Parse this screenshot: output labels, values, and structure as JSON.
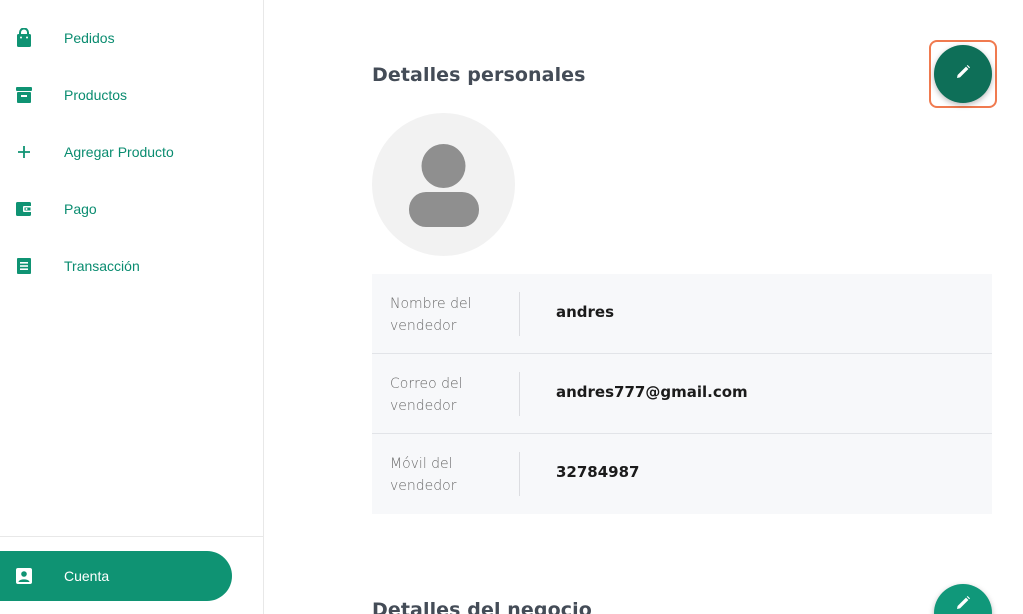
{
  "sidebar": {
    "items": [
      {
        "label": "Pedidos",
        "icon": "shopping-bag-icon"
      },
      {
        "label": "Productos",
        "icon": "archive-box-icon"
      },
      {
        "label": "Agregar Producto",
        "icon": "plus-icon"
      },
      {
        "label": "Pago",
        "icon": "wallet-icon"
      },
      {
        "label": "Transacción",
        "icon": "receipt-list-icon"
      }
    ],
    "active_item": {
      "label": "Cuenta",
      "icon": "account-box-icon"
    }
  },
  "personal": {
    "title": "Detalles personales",
    "edit_icon": "pencil-icon",
    "avatar_icon": "person-icon",
    "rows": [
      {
        "label": "Nombre del vendedor",
        "value": "andres"
      },
      {
        "label": "Correo del vendedor",
        "value": "andres777@gmail.com"
      },
      {
        "label": "Móvil del vendedor",
        "value": "32784987"
      }
    ]
  },
  "business": {
    "title": "Detalles del negocio",
    "edit_icon": "pencil-icon"
  },
  "colors": {
    "accent": "#0f9373",
    "fab_dark": "#0e6f58",
    "focus_outline": "#f07a4f",
    "nav_text": "#0a8c70"
  }
}
